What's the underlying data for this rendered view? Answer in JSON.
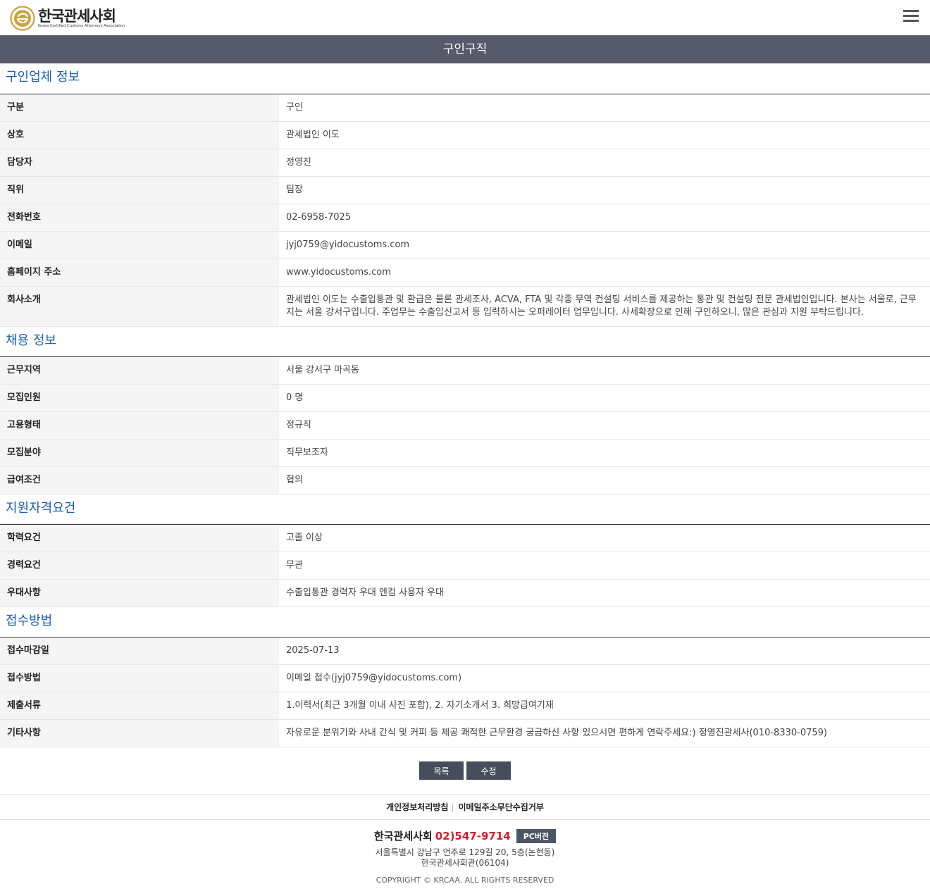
{
  "header": {
    "logo_title": "한국관세사회",
    "logo_subtitle": "Korea Certified Customs Attorneys Association",
    "menu_icon": "hamburger-icon"
  },
  "page_title": "구인구직",
  "sections": [
    {
      "title": "구인업체 정보",
      "rows": [
        {
          "label": "구분",
          "value": "구인"
        },
        {
          "label": "상호",
          "value": "관세법인 이도"
        },
        {
          "label": "담당자",
          "value": "정영진"
        },
        {
          "label": "직위",
          "value": "팀장"
        },
        {
          "label": "전화번호",
          "value": "02-6958-7025"
        },
        {
          "label": "이메일",
          "value": "jyj0759@yidocustoms.com"
        },
        {
          "label": "홈페이지 주소",
          "value": "www.yidocustoms.com"
        },
        {
          "label": "회사소개",
          "value": "관세법인 이도는 수출입통관 및 환급은 물론 관세조사, ACVA, FTA 및 각종 무역 컨설팅 서비스를 제공하는 통관 및 컨설팅 전문 관세법인입니다. 본사는 서울로, 근무지는 서울 강서구입니다. 주업무는 수출입신고서 등 입력하시는 오퍼레이터 업무입니다. 사세확장으로 인해 구인하오니, 많은 관심과 지원 부탁드립니다."
        }
      ]
    },
    {
      "title": "채용 정보",
      "rows": [
        {
          "label": "근무지역",
          "value": "서울 강서구 마곡동"
        },
        {
          "label": "모집인원",
          "value": "0 명"
        },
        {
          "label": "고용형태",
          "value": "정규직"
        },
        {
          "label": "모집분야",
          "value": "직무보조자"
        },
        {
          "label": "급여조건",
          "value": "협의"
        }
      ]
    },
    {
      "title": "지원자격요건",
      "rows": [
        {
          "label": "학력요건",
          "value": "고졸 이상"
        },
        {
          "label": "경력요건",
          "value": "무관"
        },
        {
          "label": "우대사항",
          "value": "수출입통관 경력자 우대 엔컴 사용자 우대"
        }
      ]
    },
    {
      "title": "접수방법",
      "rows": [
        {
          "label": "접수마감일",
          "value": "2025-07-13"
        },
        {
          "label": "접수방법",
          "value": "이메일 접수(jyj0759@yidocustoms.com)"
        },
        {
          "label": "제출서류",
          "value": "1.이력서(최근 3개월 이내 사진 포함), 2. 자기소개서 3. 희망급여기재"
        },
        {
          "label": "기타사항",
          "value": "자유로운 분위기와 사내 간식 및 커피 등 제공 쾌적한 근무환경 궁금하신 사항 있으시면 편하게 연락주세요:) 정영진관세사(010-8330-0759)"
        }
      ]
    }
  ],
  "buttons": {
    "list_label": "목록",
    "edit_label": "수정"
  },
  "footer": {
    "link_privacy": "개인정보처리방침",
    "link_email_refusal": "이메일주소무단수집거부",
    "org_name": "한국관세사회",
    "phone": "02)547-9714",
    "pc_version": "PC버전",
    "address_line1": "서울특별시 강남구 언주로 129길 20, 5층(논현동)",
    "address_line2": "한국관세사회관(06104)",
    "copyright": "COPYRIGHT © KRCAA. ALL RIGHTS RESERVED"
  },
  "colors": {
    "title_bar": "#565a6b",
    "section_title": "#1a5fb4",
    "button": "#474d5a",
    "phone": "#d0202c",
    "logo_gold": "#c9a43a"
  }
}
